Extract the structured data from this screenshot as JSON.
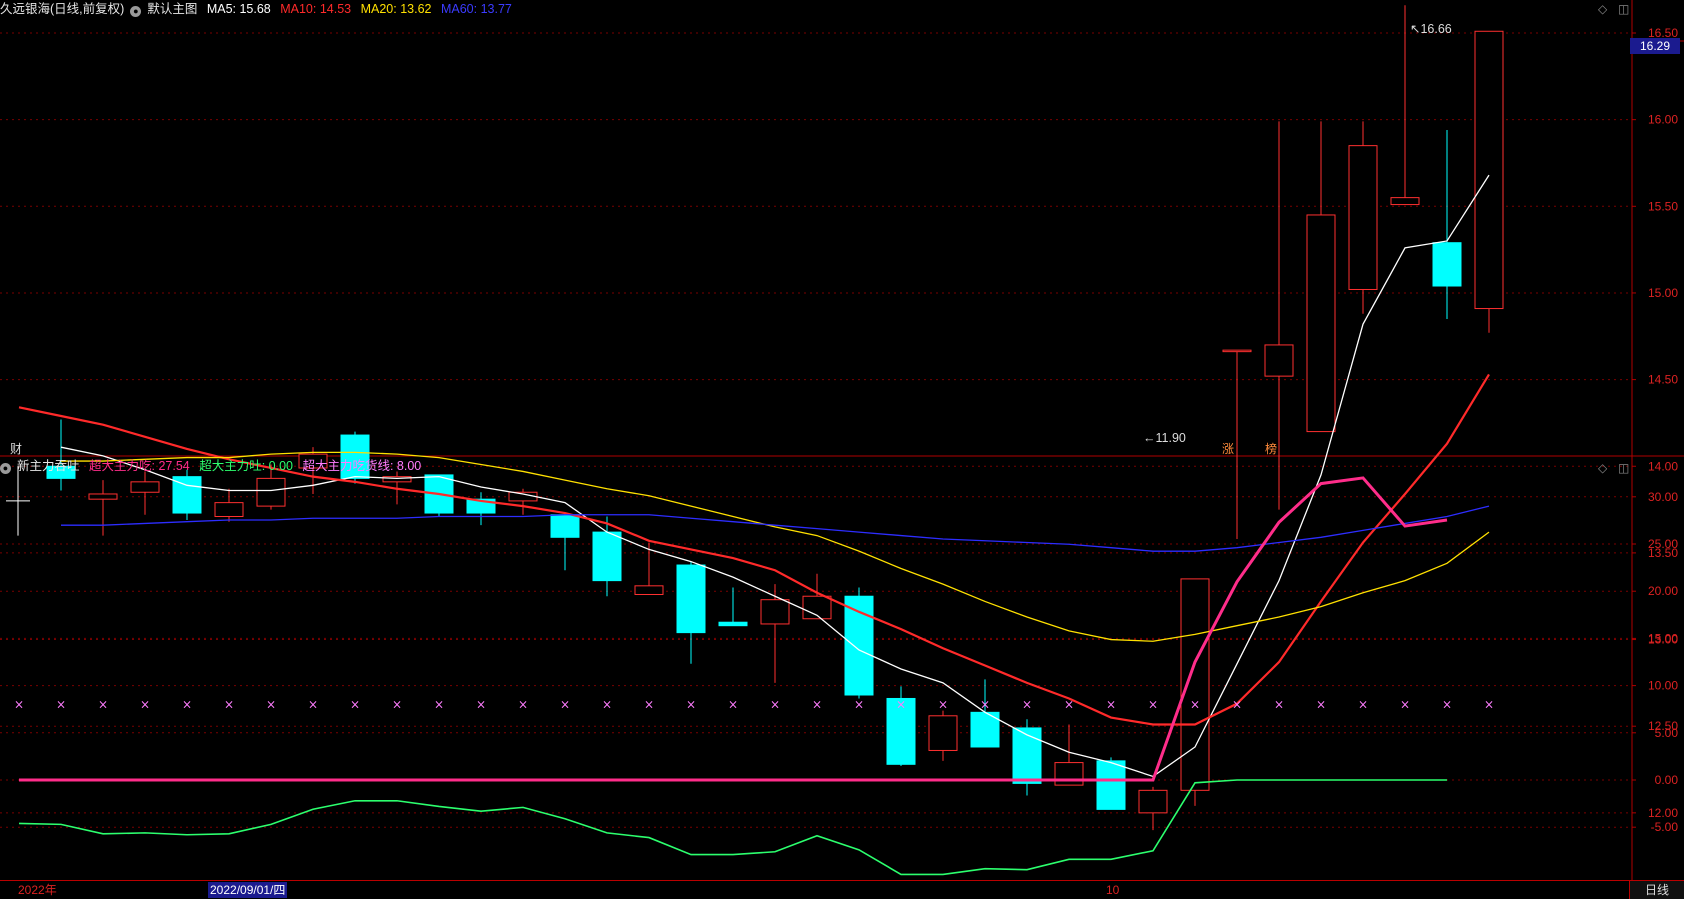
{
  "main_header": {
    "stock_name": "久远银海(日线,前复权)",
    "chart_label": "默认主图",
    "ma_labels": [
      {
        "label": "MA5: 15.68",
        "color": "#ffffff"
      },
      {
        "label": "MA10: 14.53",
        "color": "#ff2a2a"
      },
      {
        "label": "MA20: 13.62",
        "color": "#ffe000"
      },
      {
        "label": "MA60: 13.77",
        "color": "#2d2dff"
      }
    ]
  },
  "indicator_header": {
    "name": "新主力吞吐",
    "labels": [
      {
        "label": "超大主力吃: 27.54",
        "color": "#ff2d8a"
      },
      {
        "label": "超大主力吐: 0.00",
        "color": "#2cff6e"
      },
      {
        "label": "超大主力吃货线: 8.00",
        "color": "#ff7dff"
      }
    ]
  },
  "window_icons": [
    "◇",
    "◫"
  ],
  "price_tag": "16.29",
  "high_label": "16.66",
  "low_label": "11.90",
  "markers": [
    "财",
    "涨",
    "榜"
  ],
  "bottom_bar": {
    "dates": [
      "2022年",
      "2022/09/01/四",
      "10"
    ],
    "period_button": "日线"
  },
  "chart_data": [
    {
      "type": "candlestick",
      "title": "久远银海(日线,前复权)",
      "ylim": [
        11.7,
        16.75
      ],
      "y_ticks": [
        "16.50",
        "16.00",
        "15.50",
        "15.00",
        "14.50",
        "14.00",
        "13.50",
        "13.00",
        "12.50",
        "12.00"
      ],
      "candles": [
        {
          "o": 13.93,
          "h": 14.27,
          "l": 13.86,
          "c": 14.0,
          "up": false
        },
        {
          "o": 13.81,
          "h": 13.92,
          "l": 13.6,
          "c": 13.84,
          "up": true
        },
        {
          "o": 13.85,
          "h": 13.97,
          "l": 13.72,
          "c": 13.91,
          "up": true
        },
        {
          "o": 13.94,
          "h": 13.98,
          "l": 13.69,
          "c": 13.73,
          "up": false
        },
        {
          "o": 13.71,
          "h": 13.87,
          "l": 13.68,
          "c": 13.79,
          "up": true
        },
        {
          "o": 13.77,
          "h": 14.01,
          "l": 13.75,
          "c": 13.93,
          "up": true
        },
        {
          "o": 13.99,
          "h": 14.11,
          "l": 13.84,
          "c": 14.07,
          "up": true
        },
        {
          "o": 14.18,
          "h": 14.2,
          "l": 13.9,
          "c": 13.93,
          "up": false
        },
        {
          "o": 13.94,
          "h": 13.97,
          "l": 13.78,
          "c": 13.91,
          "up": true
        },
        {
          "o": 13.95,
          "h": 13.95,
          "l": 13.71,
          "c": 13.73,
          "up": false
        },
        {
          "o": 13.81,
          "h": 13.85,
          "l": 13.66,
          "c": 13.73,
          "up": false
        },
        {
          "o": 13.8,
          "h": 13.87,
          "l": 13.72,
          "c": 13.85,
          "up": true
        },
        {
          "o": 13.72,
          "h": 13.73,
          "l": 13.4,
          "c": 13.59,
          "up": false
        },
        {
          "o": 13.62,
          "h": 13.71,
          "l": 13.25,
          "c": 13.34,
          "up": false
        },
        {
          "o": 13.26,
          "h": 13.56,
          "l": 13.26,
          "c": 13.31,
          "up": true
        },
        {
          "o": 13.43,
          "h": 13.45,
          "l": 12.86,
          "c": 13.04,
          "up": false
        },
        {
          "o": 13.08,
          "h": 13.3,
          "l": 13.08,
          "c": 13.1,
          "up": false
        },
        {
          "o": 13.09,
          "h": 13.32,
          "l": 12.75,
          "c": 13.23,
          "up": true
        },
        {
          "o": 13.12,
          "h": 13.38,
          "l": 13.12,
          "c": 13.25,
          "up": true
        },
        {
          "o": 13.25,
          "h": 13.3,
          "l": 12.66,
          "c": 12.68,
          "up": false
        },
        {
          "o": 12.66,
          "h": 12.73,
          "l": 12.27,
          "c": 12.28,
          "up": false
        },
        {
          "o": 12.36,
          "h": 12.59,
          "l": 12.3,
          "c": 12.56,
          "up": true
        },
        {
          "o": 12.58,
          "h": 12.77,
          "l": 12.38,
          "c": 12.38,
          "up": false
        },
        {
          "o": 12.49,
          "h": 12.54,
          "l": 12.1,
          "c": 12.17,
          "up": false
        },
        {
          "o": 12.16,
          "h": 12.51,
          "l": 12.16,
          "c": 12.29,
          "up": true
        },
        {
          "o": 12.3,
          "h": 12.32,
          "l": 12.02,
          "c": 12.02,
          "up": false
        },
        {
          "o": 12.0,
          "h": 12.15,
          "l": 11.9,
          "c": 12.13,
          "up": true
        },
        {
          "o": 12.13,
          "h": 13.35,
          "l": 12.04,
          "c": 13.35,
          "up": true
        },
        {
          "o": 14.67,
          "h": 14.67,
          "l": 13.58,
          "c": 14.67,
          "up": true
        },
        {
          "o": 14.52,
          "h": 15.99,
          "l": 13.75,
          "c": 14.7,
          "up": true
        },
        {
          "o": 14.2,
          "h": 15.99,
          "l": 14.2,
          "c": 15.45,
          "up": true
        },
        {
          "o": 15.02,
          "h": 15.99,
          "l": 14.88,
          "c": 15.85,
          "up": true
        },
        {
          "o": 15.51,
          "h": 16.66,
          "l": 15.51,
          "c": 15.55,
          "up": true
        },
        {
          "o": 15.29,
          "h": 15.94,
          "l": 14.85,
          "c": 15.04,
          "up": false
        },
        {
          "o": 14.91,
          "h": 16.51,
          "l": 14.77,
          "c": 16.51,
          "up": true
        }
      ],
      "series": [
        {
          "name": "MA5",
          "color": "#ffffff",
          "values": [
            14.11,
            14.06,
            13.98,
            13.89,
            13.86,
            13.86,
            13.89,
            13.94,
            13.93,
            13.94,
            13.88,
            13.84,
            13.79,
            13.62,
            13.52,
            13.45,
            13.36,
            13.25,
            13.14,
            12.94,
            12.83,
            12.75,
            12.58,
            12.45,
            12.35,
            12.29,
            12.21,
            12.38,
            12.86,
            13.34,
            13.95,
            14.82,
            15.26,
            15.3,
            15.68
          ]
        },
        {
          "name": "MA10",
          "color": "#ff2a2a",
          "values": [
            14.34,
            14.29,
            14.24,
            14.17,
            14.1,
            14.04,
            13.99,
            13.94,
            13.91,
            13.87,
            13.84,
            13.8,
            13.77,
            13.73,
            13.67,
            13.57,
            13.52,
            13.47,
            13.4,
            13.27,
            13.16,
            13.06,
            12.95,
            12.85,
            12.75,
            12.66,
            12.55,
            12.51,
            12.51,
            12.63,
            12.87,
            13.22,
            13.56,
            13.84,
            14.13,
            14.53
          ]
        },
        {
          "name": "MA20",
          "color": "#ffe000",
          "values": [
            14.03,
            14.03,
            14.04,
            14.05,
            14.05,
            14.07,
            14.08,
            14.08,
            14.07,
            14.05,
            14.01,
            13.97,
            13.92,
            13.87,
            13.83,
            13.77,
            13.71,
            13.65,
            13.6,
            13.51,
            13.41,
            13.32,
            13.22,
            13.13,
            13.05,
            13.0,
            12.99,
            13.03,
            13.08,
            13.13,
            13.19,
            13.27,
            13.34,
            13.44,
            13.62
          ]
        },
        {
          "name": "MA60",
          "color": "#2d2dff",
          "values": [
            13.66,
            13.66,
            13.67,
            13.68,
            13.69,
            13.69,
            13.7,
            13.7,
            13.7,
            13.71,
            13.71,
            13.71,
            13.72,
            13.72,
            13.72,
            13.7,
            13.68,
            13.66,
            13.64,
            13.62,
            13.6,
            13.58,
            13.57,
            13.56,
            13.55,
            13.53,
            13.51,
            13.51,
            13.53,
            13.56,
            13.59,
            13.63,
            13.67,
            13.71,
            13.77
          ]
        }
      ]
    },
    {
      "type": "line",
      "title": "新主力吞吐",
      "ylim": [
        -10.3,
        34.2
      ],
      "y_ticks": [
        "30.00",
        "25.00",
        "20.00",
        "15.00",
        "10.00",
        "5.00",
        "0.00",
        "-5.00"
      ],
      "series": [
        {
          "name": "超大主力吃",
          "color": "#ff2d8a",
          "values": [
            0,
            0,
            0,
            0,
            0,
            0,
            0,
            0,
            0,
            0,
            0,
            0,
            0,
            0,
            0,
            0,
            0,
            0,
            0,
            0,
            0,
            0,
            0,
            0,
            0,
            0,
            0,
            0,
            12.5,
            21.0,
            27.3,
            31.4,
            32.0,
            26.9,
            27.54
          ]
        },
        {
          "name": "超大主力吐",
          "color": "#2cff6e",
          "values": [
            -4.6,
            -4.7,
            -5.7,
            -5.6,
            -5.8,
            -5.7,
            -4.7,
            -3.1,
            -2.2,
            -2.2,
            -2.8,
            -3.3,
            -2.9,
            -4.1,
            -5.6,
            -6.1,
            -7.9,
            -7.9,
            -7.6,
            -5.9,
            -7.4,
            -10.0,
            -10.0,
            -9.4,
            -9.5,
            -8.4,
            -8.4,
            -7.5,
            -0.3,
            0,
            0,
            0,
            0,
            0,
            0
          ]
        },
        {
          "name": "超大主力吃货线",
          "color": "#ff7dff",
          "values": [
            8,
            8,
            8,
            8,
            8,
            8,
            8,
            8,
            8,
            8,
            8,
            8,
            8,
            8,
            8,
            8,
            8,
            8,
            8,
            8,
            8,
            8,
            8,
            8,
            8,
            8,
            8,
            8,
            8,
            8,
            8,
            8,
            8,
            8,
            8,
            8
          ]
        }
      ]
    }
  ]
}
